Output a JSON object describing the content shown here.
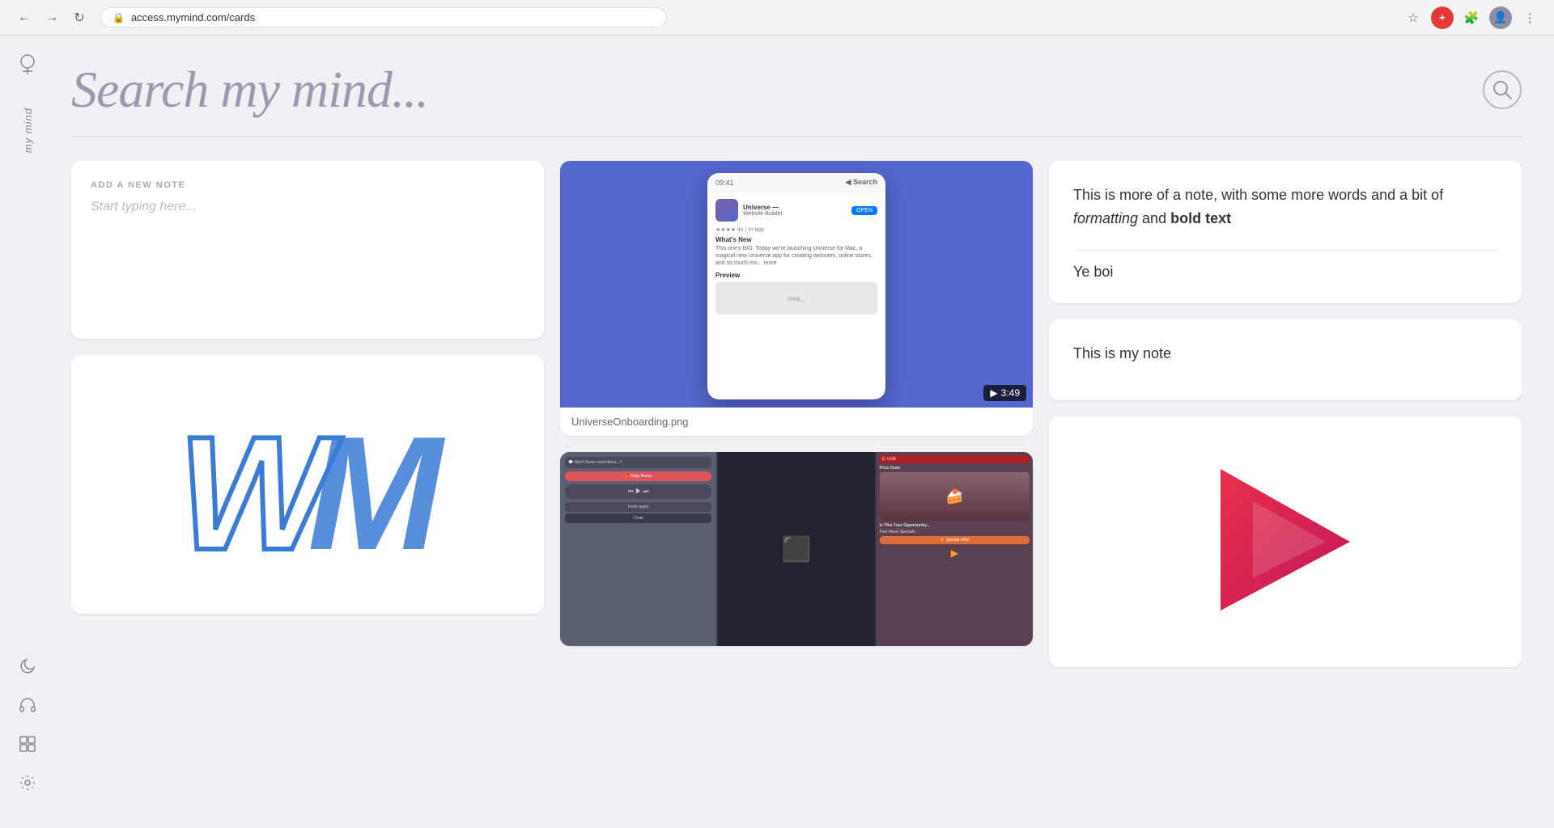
{
  "browser": {
    "url": "access.mymind.com/cards",
    "nav_back": "←",
    "nav_forward": "→",
    "nav_refresh": "↻"
  },
  "header": {
    "title": "Search my mind...",
    "search_label": "Search"
  },
  "sidebar": {
    "logo_label": "my mind",
    "items": [
      {
        "name": "moon-icon",
        "symbol": "🌙",
        "label": "Dark mode"
      },
      {
        "name": "headphones-icon",
        "symbol": "🎧",
        "label": "Audio"
      },
      {
        "name": "grid-icon",
        "symbol": "⊞",
        "label": "Grid view"
      },
      {
        "name": "settings-icon",
        "symbol": "⚙",
        "label": "Settings"
      }
    ]
  },
  "add_note": {
    "label": "ADD A NEW NOTE",
    "placeholder": "Start typing here..."
  },
  "cards": [
    {
      "type": "image_video",
      "title": "UniverseOnboarding.png",
      "duration": "3:49",
      "bg_color": "#5566cc"
    },
    {
      "type": "note",
      "text_parts": [
        {
          "text": "This is more of a note, with some more words and a bit of ",
          "style": "normal"
        },
        {
          "text": "formatting",
          "style": "italic"
        },
        {
          "text": " and ",
          "style": "normal"
        },
        {
          "text": "bold text",
          "style": "bold"
        }
      ],
      "secondary_text": "Ye boi"
    },
    {
      "type": "note_simple",
      "text": "This is my note"
    },
    {
      "type": "wm_logo",
      "letters": "WM"
    },
    {
      "type": "screenshots",
      "description": "App screenshots"
    },
    {
      "type": "play_button",
      "description": "Video play button"
    }
  ]
}
